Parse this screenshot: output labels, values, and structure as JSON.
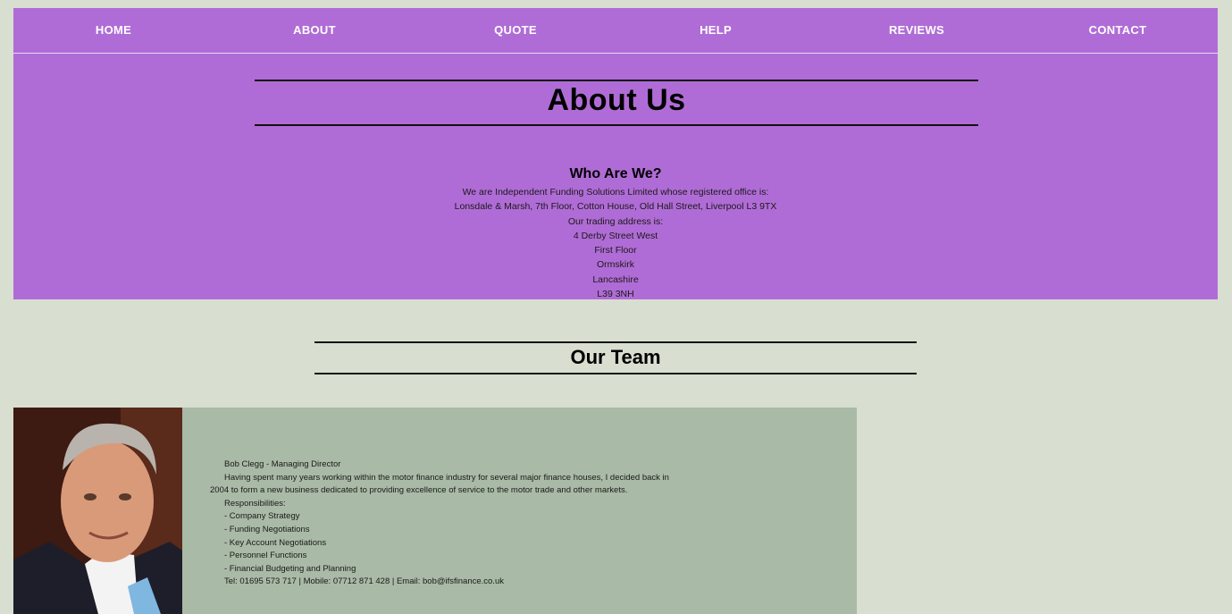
{
  "nav": {
    "items": [
      {
        "label": "HOME"
      },
      {
        "label": "ABOUT"
      },
      {
        "label": "QUOTE"
      },
      {
        "label": "HELP"
      },
      {
        "label": "REVIEWS"
      },
      {
        "label": "CONTACT"
      }
    ]
  },
  "colors": {
    "page_background": "#d8dfd0",
    "band": "#b06cd6",
    "card": "#a9baa6"
  },
  "about": {
    "title": "About Us",
    "who_heading": "Who Are We?",
    "lines": [
      "We are Independent Funding Solutions Limited whose registered office is:",
      "Lonsdale & Marsh, 7th Floor, Cotton House, Old Hall Street, Liverpool L3 9TX",
      "Our trading address is:",
      "4 Derby Street West",
      "First Floor",
      "Ormskirk",
      "Lancashire",
      "L39 3NH"
    ]
  },
  "team": {
    "title": "Our Team",
    "members": [
      {
        "name_role": "Bob Clegg - Managing Director",
        "bio": "Having spent many years working within the motor finance industry for several major finance houses, I decided back in 2004 to form a new business dedicated to providing excellence of service to the motor trade and other markets.",
        "responsibilities_label": "Responsibilities:",
        "responsibilities": [
          "- Company Strategy",
          "- Funding Negotiations",
          "- Key Account Negotiations",
          "- Personnel Functions",
          "- Financial Budgeting and Planning"
        ],
        "contact": "Tel: 01695 573 717 | Mobile: 07712 871 428 | Email: bob@ifsfinance.co.uk"
      }
    ]
  }
}
